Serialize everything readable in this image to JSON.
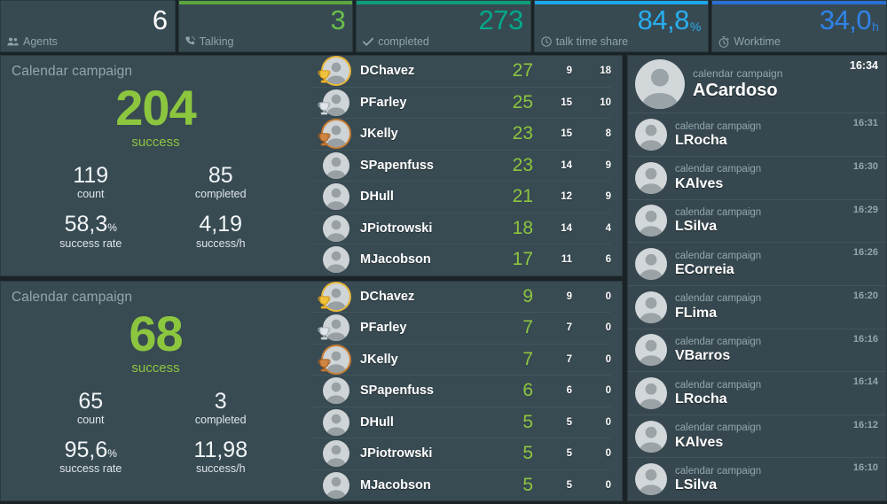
{
  "kpis": [
    {
      "value": "6",
      "unit": "",
      "label": "Agents",
      "icon": "users-icon",
      "accent": "",
      "value_color": "#ffffff"
    },
    {
      "value": "3",
      "unit": "",
      "label": "Talking",
      "icon": "phone-icon",
      "accent": "#5aa63c",
      "value_color": "#6abf4b"
    },
    {
      "value": "273",
      "unit": "",
      "label": "completed",
      "icon": "check-icon",
      "accent": "#0e9e79",
      "value_color": "#00a98a"
    },
    {
      "value": "84,8",
      "unit": "%",
      "label": "talk time share",
      "icon": "clock-icon",
      "accent": "#1ea7ec",
      "value_color": "#29aef0"
    },
    {
      "value": "34,0",
      "unit": "h",
      "label": "Worktime",
      "icon": "stopwatch-icon",
      "accent": "#2a6fd4",
      "value_color": "#2f84e8"
    }
  ],
  "campaigns": [
    {
      "title": "Calendar campaign",
      "hero_value": "204",
      "hero_label": "success",
      "stats": [
        {
          "value": "119",
          "suffix": "",
          "label": "count"
        },
        {
          "value": "85",
          "suffix": "",
          "label": "completed"
        },
        {
          "value": "58,3",
          "suffix": "%",
          "label": "success rate"
        },
        {
          "value": "4,19",
          "suffix": "",
          "label": "success/h"
        }
      ],
      "leaderboard": [
        {
          "name": "DChavez",
          "main": "27",
          "sub1": "9",
          "sub2": "18",
          "medal": "gold"
        },
        {
          "name": "PFarley",
          "main": "25",
          "sub1": "15",
          "sub2": "10",
          "medal": "silver"
        },
        {
          "name": "JKelly",
          "main": "23",
          "sub1": "15",
          "sub2": "8",
          "medal": "bronze"
        },
        {
          "name": "SPapenfuss",
          "main": "23",
          "sub1": "14",
          "sub2": "9",
          "medal": ""
        },
        {
          "name": "DHull",
          "main": "21",
          "sub1": "12",
          "sub2": "9",
          "medal": ""
        },
        {
          "name": "JPiotrowski",
          "main": "18",
          "sub1": "14",
          "sub2": "4",
          "medal": ""
        },
        {
          "name": "MJacobson",
          "main": "17",
          "sub1": "11",
          "sub2": "6",
          "medal": ""
        }
      ]
    },
    {
      "title": "Calendar campaign",
      "hero_value": "68",
      "hero_label": "success",
      "stats": [
        {
          "value": "65",
          "suffix": "",
          "label": "count"
        },
        {
          "value": "3",
          "suffix": "",
          "label": "completed"
        },
        {
          "value": "95,6",
          "suffix": "%",
          "label": "success rate"
        },
        {
          "value": "11,98",
          "suffix": "",
          "label": "success/h"
        }
      ],
      "leaderboard": [
        {
          "name": "DChavez",
          "main": "9",
          "sub1": "9",
          "sub2": "0",
          "medal": "gold"
        },
        {
          "name": "PFarley",
          "main": "7",
          "sub1": "7",
          "sub2": "0",
          "medal": "silver"
        },
        {
          "name": "JKelly",
          "main": "7",
          "sub1": "7",
          "sub2": "0",
          "medal": "bronze"
        },
        {
          "name": "SPapenfuss",
          "main": "6",
          "sub1": "6",
          "sub2": "0",
          "medal": ""
        },
        {
          "name": "DHull",
          "main": "5",
          "sub1": "5",
          "sub2": "0",
          "medal": ""
        },
        {
          "name": "JPiotrowski",
          "main": "5",
          "sub1": "5",
          "sub2": "0",
          "medal": ""
        },
        {
          "name": "MJacobson",
          "main": "5",
          "sub1": "5",
          "sub2": "0",
          "medal": ""
        }
      ]
    }
  ],
  "feed": [
    {
      "campaign": "calendar campaign",
      "name": "ACardoso",
      "time": "16:34"
    },
    {
      "campaign": "calendar campaign",
      "name": "LRocha",
      "time": "16:31"
    },
    {
      "campaign": "calendar campaign",
      "name": "KAlves",
      "time": "16:30"
    },
    {
      "campaign": "calendar campaign",
      "name": "LSilva",
      "time": "16:29"
    },
    {
      "campaign": "calendar campaign",
      "name": "ECorreia",
      "time": "16:26"
    },
    {
      "campaign": "calendar campaign",
      "name": "FLima",
      "time": "16:20"
    },
    {
      "campaign": "calendar campaign",
      "name": "VBarros",
      "time": "16:16"
    },
    {
      "campaign": "calendar campaign",
      "name": "LRocha",
      "time": "16:14"
    },
    {
      "campaign": "calendar campaign",
      "name": "KAlves",
      "time": "16:12"
    },
    {
      "campaign": "calendar campaign",
      "name": "LSilva",
      "time": "16:10"
    }
  ]
}
